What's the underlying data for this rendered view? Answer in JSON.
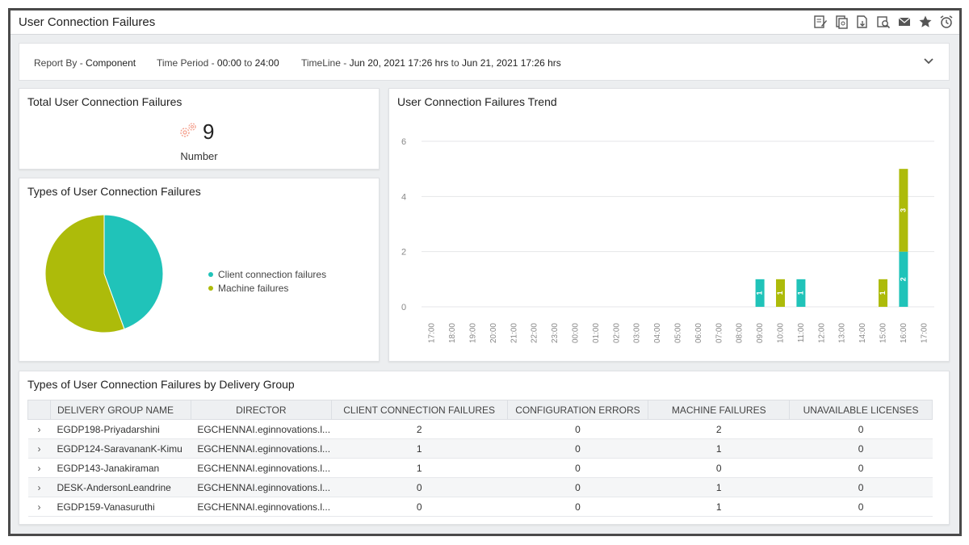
{
  "window": {
    "title": "User Connection Failures"
  },
  "toolbar": {
    "icons": [
      "edit-report-icon",
      "compare-icon",
      "export-pdf-icon",
      "search-report-icon",
      "email-icon",
      "favorite-icon",
      "alarm-icon"
    ]
  },
  "filters": {
    "report_by_label": "Report By - ",
    "report_by_value": "Component",
    "time_period_label": "Time Period - ",
    "time_period_value": "00:00",
    "time_period_to": " to ",
    "time_period_end": "24:00",
    "timeline_label": "TimeLine - ",
    "timeline_start": "Jun 20, 2021 17:26 hrs",
    "timeline_to": " to ",
    "timeline_end": "Jun 21, 2021 17:26 hrs"
  },
  "total": {
    "title": "Total User Connection Failures",
    "value": "9",
    "label": "Number"
  },
  "types": {
    "title": "Types of User Connection Failures",
    "legend": [
      {
        "label": "Client connection failures",
        "color": "#20c3b9"
      },
      {
        "label": "Machine failures",
        "color": "#adbb0a"
      }
    ]
  },
  "colors": {
    "client": "#20c3b9",
    "machine": "#adbb0a"
  },
  "chart_data": [
    {
      "type": "pie",
      "title": "Types of User Connection Failures",
      "categories": [
        "Client connection failures",
        "Machine failures"
      ],
      "values": [
        4,
        5
      ]
    },
    {
      "type": "bar",
      "title": "User Connection Failures Trend",
      "stacked": true,
      "categories": [
        "17:00",
        "18:00",
        "19:00",
        "20:00",
        "21:00",
        "22:00",
        "23:00",
        "00:00",
        "01:00",
        "02:00",
        "03:00",
        "04:00",
        "05:00",
        "06:00",
        "07:00",
        "08:00",
        "09:00",
        "10:00",
        "11:00",
        "12:00",
        "13:00",
        "14:00",
        "15:00",
        "16:00",
        "17:00"
      ],
      "series": [
        {
          "color": "#20c3b9",
          "values": [
            0,
            0,
            0,
            0,
            0,
            0,
            0,
            0,
            0,
            0,
            0,
            0,
            0,
            0,
            0,
            0,
            1,
            0,
            1,
            0,
            0,
            0,
            0,
            2,
            0
          ]
        },
        {
          "color": "#adbb0a",
          "values": [
            0,
            0,
            0,
            0,
            0,
            0,
            0,
            0,
            0,
            0,
            0,
            0,
            0,
            0,
            0,
            0,
            0,
            1,
            0,
            0,
            0,
            0,
            1,
            3,
            0
          ]
        }
      ],
      "ylim": [
        0,
        6
      ],
      "yticks": [
        0,
        2,
        4,
        6
      ],
      "grid": true
    }
  ],
  "table": {
    "title": "Types of User Connection Failures by Delivery Group",
    "columns": [
      "DELIVERY GROUP NAME",
      "DIRECTOR",
      "CLIENT CONNECTION FAILURES",
      "CONFIGURATION ERRORS",
      "MACHINE FAILURES",
      "UNAVAILABLE LICENSES"
    ],
    "rows": [
      [
        "EGDP198-Priyadarshini",
        "EGCHENNAI.eginnovations.l...",
        "2",
        "0",
        "2",
        "0"
      ],
      [
        "EGDP124-SaravananK-Kimu",
        "EGCHENNAI.eginnovations.l...",
        "1",
        "0",
        "1",
        "0"
      ],
      [
        "EGDP143-Janakiraman",
        "EGCHENNAI.eginnovations.l...",
        "1",
        "0",
        "0",
        "0"
      ],
      [
        "DESK-AndersonLeandrine",
        "EGCHENNAI.eginnovations.l...",
        "0",
        "0",
        "1",
        "0"
      ],
      [
        "EGDP159-Vanasuruthi",
        "EGCHENNAI.eginnovations.l...",
        "0",
        "0",
        "1",
        "0"
      ]
    ]
  }
}
